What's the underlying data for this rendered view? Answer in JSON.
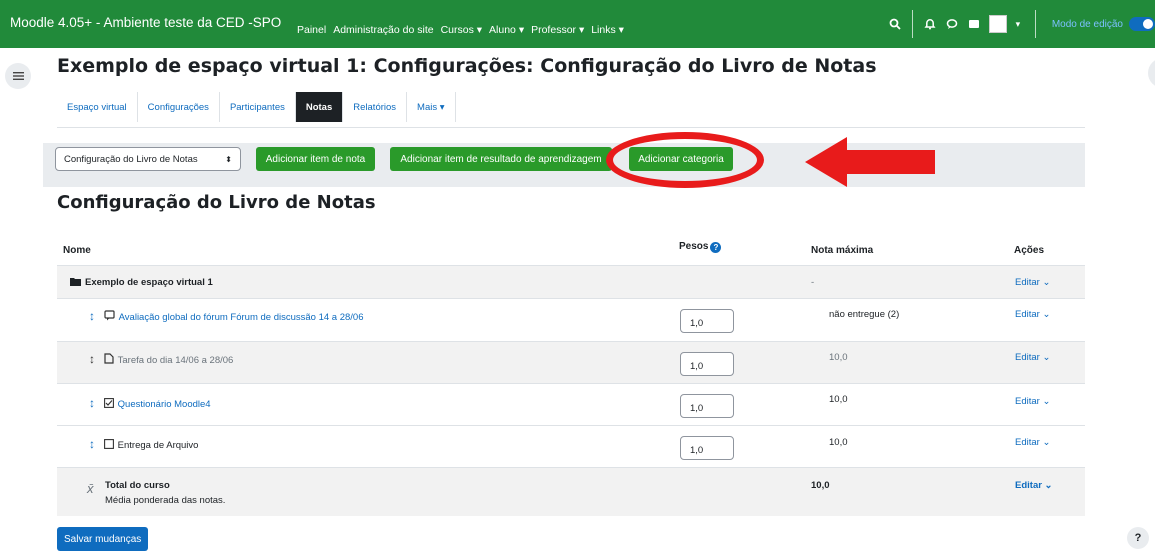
{
  "header": {
    "site_name": "Moodle 4.05+ - Ambiente teste da CED -SPO",
    "menu": [
      "Painel",
      "Administração do site",
      "Cursos ▾",
      "Aluno ▾",
      "Professor ▾",
      "Links ▾"
    ],
    "edit_mode_label": "Modo de edição",
    "icons": [
      "search-icon",
      "bell-icon",
      "chat-icon",
      "drawer-icon",
      "avatar-image",
      "chevron-down-icon"
    ]
  },
  "page": {
    "title": "Exemplo de espaço virtual 1: Configurações: Configuração do Livro de Notas",
    "tabs": [
      "Espaço virtual",
      "Configurações",
      "Participantes",
      "Notas",
      "Relatórios",
      "Mais ▾"
    ],
    "active_tab": "Notas"
  },
  "toolbar": {
    "select_value": "Configuração do Livro de Notas",
    "buttons": [
      "Adicionar item de nota",
      "Adicionar item de resultado de aprendizagem",
      "Adicionar categoria"
    ]
  },
  "section_title": "Configuração do Livro de Notas",
  "table": {
    "headers": {
      "name": "Nome",
      "weights": "Pesos",
      "max": "Nota máxima",
      "actions": "Ações"
    },
    "category": {
      "name": "Exemplo de espaço virtual 1",
      "max": "-",
      "action": "Editar ⌄"
    },
    "items": [
      {
        "name": "Avaliação global do fórum Fórum de discussão 14 a 28/06",
        "weight": "1,0",
        "max": "não entregue (2)",
        "action": "Editar ⌄"
      },
      {
        "name": "Tarefa do dia 14/06 a 28/06",
        "weight": "1,0",
        "max": "10,0",
        "action": "Editar ⌄"
      },
      {
        "name": "Questionário Moodle4",
        "weight": "1,0",
        "max": "10,0",
        "action": "Editar ⌄"
      },
      {
        "name": "Entrega de Arquivo",
        "weight": "1,0",
        "max": "10,0",
        "action": "Editar ⌄"
      }
    ],
    "total": {
      "name": "Total do curso",
      "sub": "Média ponderada das notas.",
      "max": "10,0",
      "action": "Editar ⌄"
    }
  },
  "save_label": "Salvar mudanças",
  "help_label": "?",
  "colors": {
    "navbar": "#218a3a",
    "primary": "#0f6cbf",
    "success": "#2a9a2a",
    "annotation": "#e81b1b"
  }
}
